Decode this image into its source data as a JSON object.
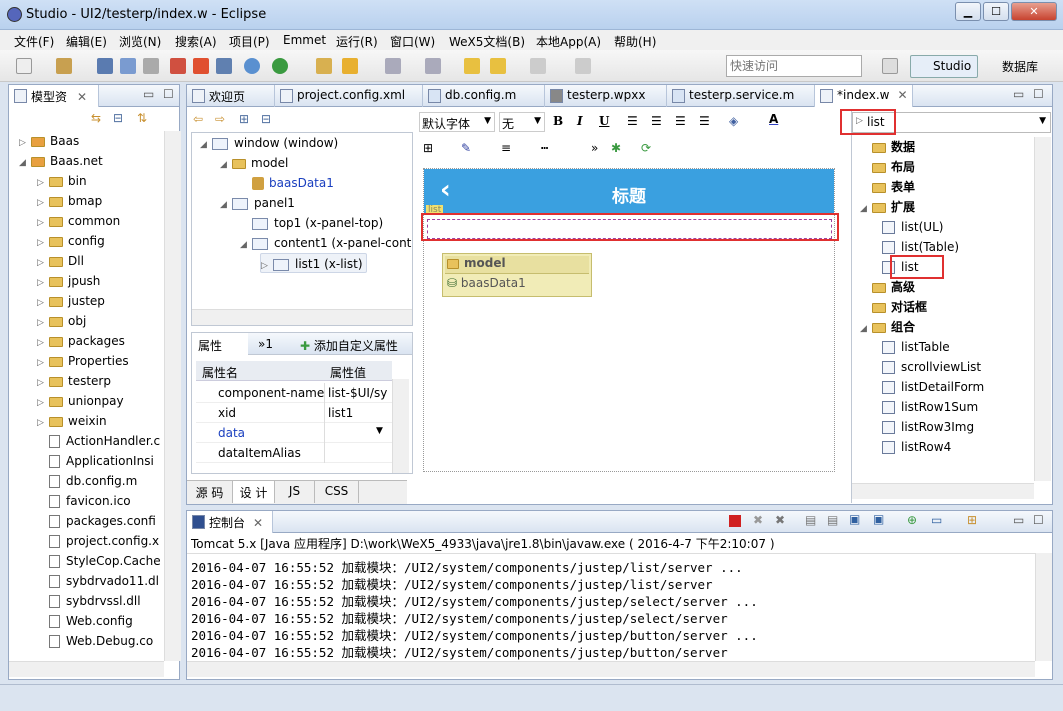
{
  "window": {
    "title": "Studio - UI2/testerp/index.w - Eclipse",
    "min": "▁",
    "max": "☐",
    "close": "✕"
  },
  "menu": [
    "文件(F)",
    "编辑(E)",
    "浏览(N)",
    "搜索(A)",
    "项目(P)",
    "Emmet",
    "运行(R)",
    "窗口(W)",
    "WeX5文档(B)",
    "本地App(A)",
    "帮助(H)"
  ],
  "toolbar": {
    "quick_access_placeholder": "快速访问",
    "studio": "Studio",
    "database": "数据库"
  },
  "model_explorer": {
    "title": "模型资",
    "items": [
      {
        "label": "Baas",
        "level": 0,
        "type": "proj"
      },
      {
        "label": "Baas.net",
        "level": 0,
        "type": "proj",
        "open": true
      },
      {
        "label": "bin",
        "level": 1,
        "type": "folder"
      },
      {
        "label": "bmap",
        "level": 1,
        "type": "folder"
      },
      {
        "label": "common",
        "level": 1,
        "type": "folder"
      },
      {
        "label": "config",
        "level": 1,
        "type": "folder"
      },
      {
        "label": "Dll",
        "level": 1,
        "type": "folder"
      },
      {
        "label": "jpush",
        "level": 1,
        "type": "folder"
      },
      {
        "label": "justep",
        "level": 1,
        "type": "folder"
      },
      {
        "label": "obj",
        "level": 1,
        "type": "folder"
      },
      {
        "label": "packages",
        "level": 1,
        "type": "folder"
      },
      {
        "label": "Properties",
        "level": 1,
        "type": "folder"
      },
      {
        "label": "testerp",
        "level": 1,
        "type": "folder"
      },
      {
        "label": "unionpay",
        "level": 1,
        "type": "folder"
      },
      {
        "label": "weixin",
        "level": 1,
        "type": "folder"
      },
      {
        "label": "ActionHandler.c",
        "level": 1,
        "type": "file"
      },
      {
        "label": "ApplicationInsi",
        "level": 1,
        "type": "file"
      },
      {
        "label": "db.config.m",
        "level": 1,
        "type": "file"
      },
      {
        "label": "favicon.ico",
        "level": 1,
        "type": "file"
      },
      {
        "label": "packages.confi",
        "level": 1,
        "type": "file"
      },
      {
        "label": "project.config.x",
        "level": 1,
        "type": "file"
      },
      {
        "label": "StyleCop.Cache",
        "level": 1,
        "type": "file"
      },
      {
        "label": "sybdrvado11.dl",
        "level": 1,
        "type": "file"
      },
      {
        "label": "sybdrvssl.dll",
        "level": 1,
        "type": "file"
      },
      {
        "label": "Web.config",
        "level": 1,
        "type": "file"
      },
      {
        "label": "Web.Debug.co",
        "level": 1,
        "type": "file"
      }
    ]
  },
  "editor_tabs": [
    "欢迎页",
    "project.config.xml",
    "db.config.m",
    "testerp.wpxx",
    "testerp.service.m",
    "*index.w"
  ],
  "outline": {
    "items": [
      {
        "label": "window (window)",
        "level": 0
      },
      {
        "label": "model",
        "level": 1
      },
      {
        "label": "baasData1",
        "level": 2,
        "blue": true
      },
      {
        "label": "panel1",
        "level": 1
      },
      {
        "label": "top1 (x-panel-top)",
        "level": 2
      },
      {
        "label": "content1 (x-panel-conte",
        "level": 2
      },
      {
        "label": "list1 (x-list)",
        "level": 3,
        "selected": true
      }
    ]
  },
  "properties": {
    "tab_label": "属性",
    "tab2": "»1",
    "add_custom": "添加自定义属性",
    "header_name": "属性名",
    "header_value": "属性值",
    "rows": [
      {
        "name": "component-name",
        "value": "list-$UI/sy"
      },
      {
        "name": "xid",
        "value": "list1"
      },
      {
        "name": "data",
        "value": "",
        "blue": true
      },
      {
        "name": "dataItemAlias",
        "value": ""
      }
    ]
  },
  "format_bar": {
    "font": "默认字体",
    "size": "无",
    "bold": "B",
    "italic": "I",
    "underline": "U"
  },
  "design": {
    "header_title": "标题",
    "back": "‹",
    "list_tag": "list",
    "model_box_title": "model",
    "model_box_item": "baasData1"
  },
  "bottom_tabs": [
    "源 码",
    "设 计",
    "JS",
    "CSS"
  ],
  "palette": {
    "search": "list",
    "items": [
      {
        "label": "数据",
        "type": "folder",
        "level": 0,
        "bold": true
      },
      {
        "label": "布局",
        "type": "folder",
        "level": 0,
        "bold": true
      },
      {
        "label": "表单",
        "type": "folder",
        "level": 0,
        "bold": true
      },
      {
        "label": "扩展",
        "type": "folder",
        "level": 0,
        "bold": true,
        "open": true
      },
      {
        "label": "list(UL)",
        "type": "comp",
        "level": 1
      },
      {
        "label": "list(Table)",
        "type": "comp",
        "level": 1
      },
      {
        "label": "list",
        "type": "comp",
        "level": 1,
        "highlight": true
      },
      {
        "label": "高级",
        "type": "folder",
        "level": 0,
        "bold": true
      },
      {
        "label": "对话框",
        "type": "folder",
        "level": 0,
        "bold": true
      },
      {
        "label": "组合",
        "type": "folder",
        "level": 0,
        "bold": true,
        "open": true
      },
      {
        "label": "listTable",
        "type": "comp",
        "level": 1
      },
      {
        "label": "scrollviewList",
        "type": "comp",
        "level": 1
      },
      {
        "label": "listDetailForm",
        "type": "comp",
        "level": 1
      },
      {
        "label": "listRow1Sum",
        "type": "comp",
        "level": 1
      },
      {
        "label": "listRow3Img",
        "type": "comp",
        "level": 1
      },
      {
        "label": "listRow4",
        "type": "comp",
        "level": 1
      }
    ]
  },
  "console": {
    "title": "控制台",
    "header": "Tomcat 5.x [Java 应用程序] D:\\work\\WeX5_4933\\java\\jre1.8\\bin\\javaw.exe ( 2016-4-7 下午2:10:07 )",
    "lines": [
      "2016-04-07 16:55:52 加载模块：/UI2/system/components/justep/list/server ...",
      "2016-04-07 16:55:52 加载模块：/UI2/system/components/justep/list/server",
      "2016-04-07 16:55:52 加载模块：/UI2/system/components/justep/select/server ...",
      "2016-04-07 16:55:52 加载模块：/UI2/system/components/justep/select/server",
      "2016-04-07 16:55:52 加载模块：/UI2/system/components/justep/button/server ...",
      "2016-04-07 16:55:52 加载模块：/UI2/system/components/justep/button/server"
    ]
  },
  "colors": {
    "accent": "#3aa0e0",
    "highlight": "#e03030",
    "blue_text": "#1a3fbf"
  }
}
